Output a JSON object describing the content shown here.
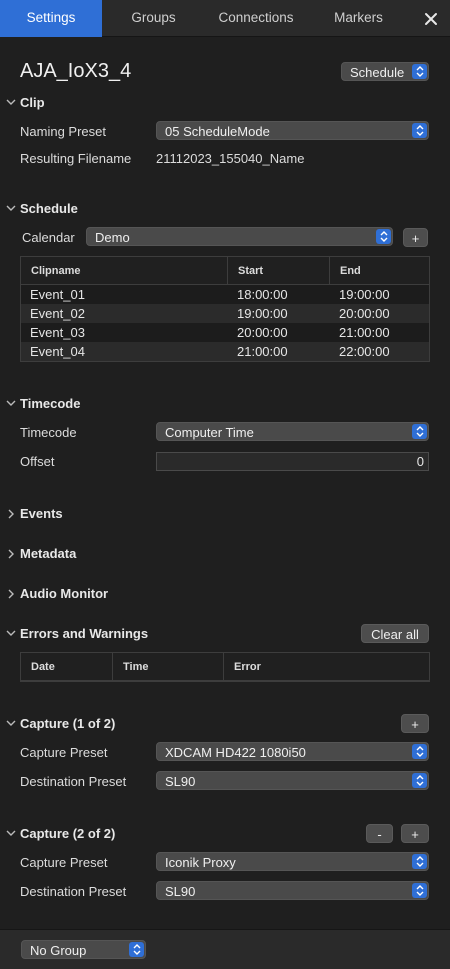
{
  "tabs": [
    {
      "label": "Settings",
      "active": true
    },
    {
      "label": "Groups"
    },
    {
      "label": "Connections"
    },
    {
      "label": "Markers"
    }
  ],
  "header": {
    "title": "AJA_IoX3_4",
    "mode_select": "Schedule"
  },
  "clip": {
    "heading": "Clip",
    "naming_preset_label": "Naming Preset",
    "naming_preset_value": "05 ScheduleMode",
    "resulting_filename_label": "Resulting Filename",
    "resulting_filename_value": "21112023_155040_Name"
  },
  "schedule": {
    "heading": "Schedule",
    "calendar_label": "Calendar",
    "calendar_value": "Demo",
    "add_label": "+",
    "columns": [
      "Clipname",
      "Start",
      "End"
    ],
    "rows": [
      {
        "name": "Event_01",
        "start": "18:00:00",
        "end": "19:00:00"
      },
      {
        "name": "Event_02",
        "start": "19:00:00",
        "end": "20:00:00"
      },
      {
        "name": "Event_03",
        "start": "20:00:00",
        "end": "21:00:00"
      },
      {
        "name": "Event_04",
        "start": "21:00:00",
        "end": "22:00:00"
      }
    ]
  },
  "timecode": {
    "heading": "Timecode",
    "timecode_label": "Timecode",
    "timecode_value": "Computer Time",
    "offset_label": "Offset",
    "offset_value": "0"
  },
  "collapsed_sections": {
    "events": "Events",
    "metadata": "Metadata",
    "audio_monitor": "Audio Monitor"
  },
  "errors": {
    "heading": "Errors and Warnings",
    "clear_label": "Clear all",
    "columns": [
      "Date",
      "Time",
      "Error"
    ]
  },
  "capture1": {
    "heading": "Capture (1 of 2)",
    "add_label": "+",
    "capture_preset_label": "Capture Preset",
    "capture_preset_value": "XDCAM HD422 1080i50",
    "destination_preset_label": "Destination Preset",
    "destination_preset_value": "SL90"
  },
  "capture2": {
    "heading": "Capture (2 of 2)",
    "remove_label": "-",
    "add_label": "+",
    "capture_preset_label": "Capture Preset",
    "capture_preset_value": "Iconik Proxy",
    "destination_preset_label": "Destination Preset",
    "destination_preset_value": "SL90"
  },
  "footer": {
    "group_select": "No Group"
  },
  "colors": {
    "accent": "#2f6fd6",
    "background": "#1f1f1f",
    "control": "#4a4a4a"
  }
}
